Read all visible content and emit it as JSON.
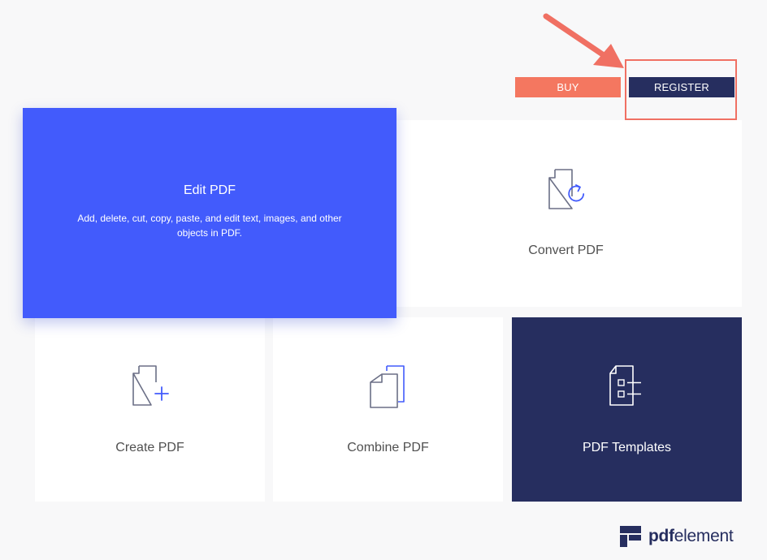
{
  "header": {
    "buy_label": "BUY",
    "register_label": "REGISTER"
  },
  "cards": {
    "edit": {
      "title": "Edit PDF",
      "description": "Add, delete, cut, copy, paste, and edit text, images, and other objects in PDF."
    },
    "convert": {
      "label": "Convert PDF",
      "icon": "convert-pdf-icon"
    },
    "create": {
      "label": "Create PDF",
      "icon": "create-pdf-icon"
    },
    "combine": {
      "label": "Combine PDF",
      "icon": "combine-pdf-icon"
    },
    "templates": {
      "label": "PDF Templates",
      "icon": "pdf-templates-icon"
    }
  },
  "brand": {
    "name_bold": "pdf",
    "name_rest": "element"
  },
  "colors": {
    "primary_blue": "#425bfc",
    "navy": "#262e5f",
    "buy_coral": "#f47760",
    "annotation_red": "#f07063",
    "background": "#f8f8f9"
  }
}
